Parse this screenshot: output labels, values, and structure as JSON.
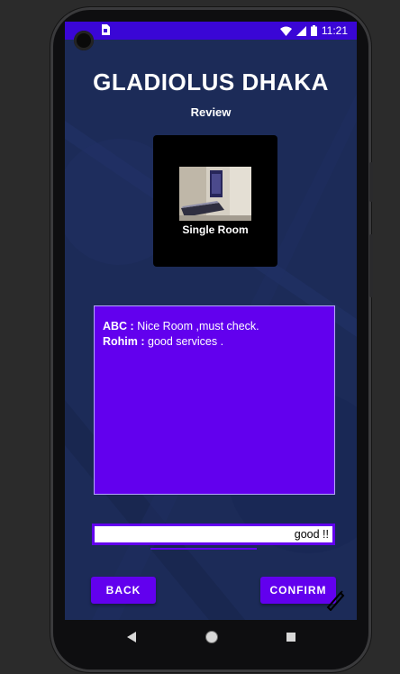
{
  "status_bar": {
    "time": "11:21",
    "icons": [
      "camera-notification-icon",
      "sim-card-icon",
      "wifi-icon",
      "signal-icon",
      "battery-icon"
    ]
  },
  "header": {
    "title": "GLADIOLUS DHAKA",
    "subtitle": "Review"
  },
  "room": {
    "label": "Single Room",
    "image": "room-photo"
  },
  "reviews": [
    {
      "author": "ABC :",
      "text": " Nice Room ,must check."
    },
    {
      "author": "Rohim :",
      "text": " good services ."
    }
  ],
  "review_input": {
    "value": "good !!"
  },
  "buttons": {
    "back": "BACK",
    "confirm": "CONFIRM"
  },
  "nav_bar": {
    "icons": [
      "back-triangle-icon",
      "home-circle-icon",
      "recents-square-icon"
    ]
  },
  "colors": {
    "primary": "#6200ee",
    "status_bar": "#3a06d6",
    "background": "#1c2b58",
    "card": "#000000"
  }
}
